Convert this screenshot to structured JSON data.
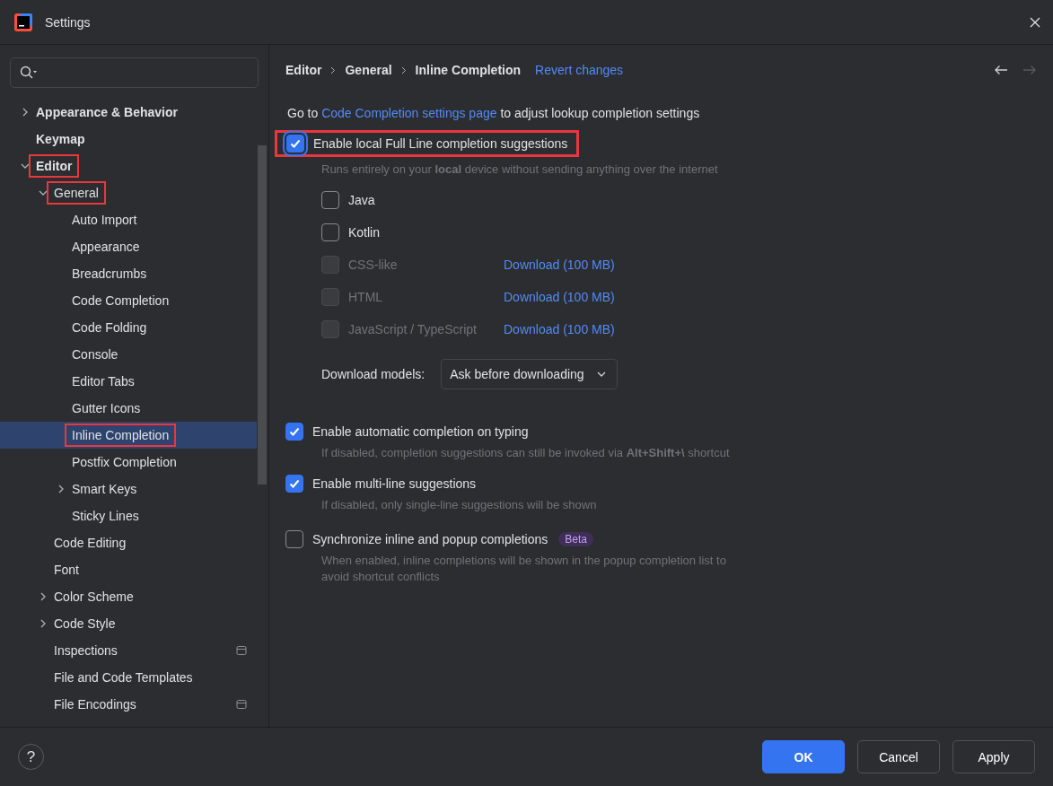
{
  "window": {
    "title": "Settings"
  },
  "sidebar": {
    "items": [
      {
        "label": "Appearance & Behavior",
        "expanded": false,
        "selected": false,
        "highlighted": false
      },
      {
        "label": "Keymap",
        "selected": false,
        "highlighted": false
      },
      {
        "label": "Editor",
        "expanded": true,
        "selected": false,
        "highlighted": true,
        "children": [
          {
            "label": "General",
            "expanded": true,
            "selected": false,
            "highlighted": true,
            "children": [
              {
                "label": "Auto Import",
                "selected": false,
                "highlighted": false
              },
              {
                "label": "Appearance",
                "selected": false,
                "highlighted": false
              },
              {
                "label": "Breadcrumbs",
                "selected": false,
                "highlighted": false
              },
              {
                "label": "Code Completion",
                "selected": false,
                "highlighted": false
              },
              {
                "label": "Code Folding",
                "selected": false,
                "highlighted": false
              },
              {
                "label": "Console",
                "selected": false,
                "highlighted": false
              },
              {
                "label": "Editor Tabs",
                "selected": false,
                "highlighted": false
              },
              {
                "label": "Gutter Icons",
                "selected": false,
                "highlighted": false
              },
              {
                "label": "Inline Completion",
                "selected": true,
                "highlighted": true
              },
              {
                "label": "Postfix Completion",
                "selected": false,
                "highlighted": false
              },
              {
                "label": "Smart Keys",
                "expanded": false,
                "selected": false,
                "highlighted": false
              },
              {
                "label": "Sticky Lines",
                "selected": false,
                "highlighted": false
              }
            ]
          },
          {
            "label": "Code Editing",
            "selected": false,
            "highlighted": false
          },
          {
            "label": "Font",
            "selected": false,
            "highlighted": false
          },
          {
            "label": "Color Scheme",
            "expanded": false,
            "selected": false,
            "highlighted": false
          },
          {
            "label": "Code Style",
            "expanded": false,
            "selected": false,
            "highlighted": false
          },
          {
            "label": "Inspections",
            "selected": false,
            "highlighted": false,
            "project_level": true
          },
          {
            "label": "File and Code Templates",
            "selected": false,
            "highlighted": false
          },
          {
            "label": "File Encodings",
            "selected": false,
            "highlighted": false,
            "project_level": true
          }
        ]
      }
    ]
  },
  "content": {
    "breadcrumbs": [
      "Editor",
      "General",
      "Inline Completion"
    ],
    "revert_link": "Revert changes",
    "intro": {
      "before": "Go to",
      "link": "Code Completion settings page",
      "after": "to adjust lookup completion settings"
    },
    "main_option": {
      "label": "Enable local Full Line completion suggestions",
      "checked": true,
      "highlighted": true,
      "hint": "Runs entirely on your **local** device without sending anything over the internet"
    },
    "languages": [
      {
        "label": "Java",
        "checked": false,
        "disabled": false
      },
      {
        "label": "Kotlin",
        "checked": false,
        "disabled": false
      },
      {
        "label": "CSS-like",
        "checked": false,
        "disabled": true,
        "download": "Download (100 MB)"
      },
      {
        "label": "HTML",
        "checked": false,
        "disabled": true,
        "download": "Download (100 MB)"
      },
      {
        "label": "JavaScript / TypeScript",
        "checked": false,
        "disabled": true,
        "download": "Download (100 MB)"
      }
    ],
    "download_models": {
      "label": "Download models:",
      "value": "Ask before downloading"
    },
    "options": [
      {
        "label": "Enable automatic completion on typing",
        "checked": true,
        "hint": "If disabled, completion suggestions can still be invoked via **Alt+Shift+\\** shortcut"
      },
      {
        "label": "Enable multi-line suggestions",
        "checked": true,
        "hint": "If disabled, only single-line suggestions will be shown"
      },
      {
        "label": "Synchronize inline and popup completions",
        "checked": false,
        "badge": "Beta",
        "hint": "When enabled, inline completions will be shown in the popup completion list to avoid shortcut conflicts"
      }
    ]
  },
  "footer": {
    "help": "?",
    "buttons": [
      {
        "label": "OK",
        "kind": "primary"
      },
      {
        "label": "Cancel",
        "kind": "secondary"
      },
      {
        "label": "Apply",
        "kind": "secondary"
      }
    ]
  }
}
